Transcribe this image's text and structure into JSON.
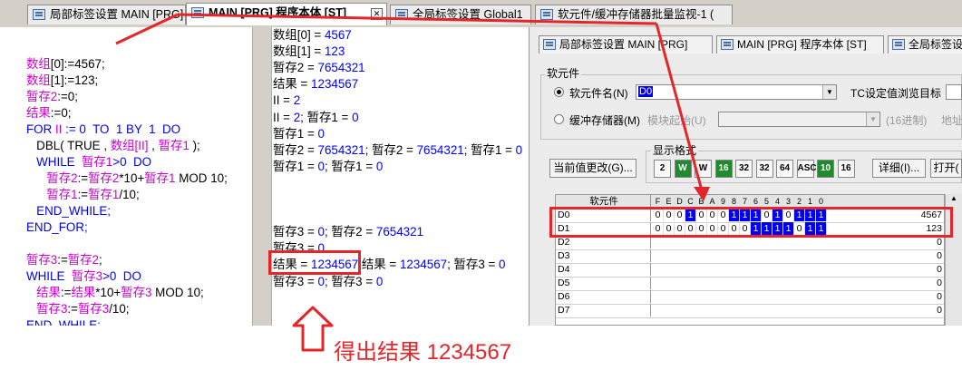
{
  "tabs": [
    {
      "label": "局部标签设置 MAIN [PRG]"
    },
    {
      "label": "MAIN [PRG] 程序本体 [ST]"
    },
    {
      "label": "全局标签设置 Global1"
    },
    {
      "label": "软元件/缓冲存储器批量监视-1 ("
    }
  ],
  "code": [
    [
      {
        "t": "数组",
        "c": "pk"
      },
      {
        "t": "[0]:=4567;",
        "c": "bk"
      }
    ],
    [
      {
        "t": "数组",
        "c": "pk"
      },
      {
        "t": "[1]:=123;",
        "c": "bk"
      }
    ],
    [
      {
        "t": "暂存2",
        "c": "pk"
      },
      {
        "t": ":=0;",
        "c": "bk"
      }
    ],
    [
      {
        "t": "结果",
        "c": "pk"
      },
      {
        "t": ":=0;",
        "c": "bk"
      }
    ],
    [
      {
        "t": "FOR ",
        "c": "bl"
      },
      {
        "t": "II",
        "c": "pk"
      },
      {
        "t": " := 0  TO  1 BY  1  DO",
        "c": "bl"
      }
    ],
    [
      {
        "t": "   DBL( TRUE , ",
        "c": "bk"
      },
      {
        "t": "数组",
        "c": "pk"
      },
      {
        "t": "[II]",
        "c": "pk"
      },
      {
        "t": " , ",
        "c": "bk"
      },
      {
        "t": "暂存1",
        "c": "pk"
      },
      {
        "t": " );",
        "c": "bk"
      }
    ],
    [
      {
        "t": "   WHILE  ",
        "c": "bl"
      },
      {
        "t": "暂存1",
        "c": "pk"
      },
      {
        "t": ">0  DO",
        "c": "bl"
      }
    ],
    [
      {
        "t": "      ",
        "c": "bk"
      },
      {
        "t": "暂存2",
        "c": "pk"
      },
      {
        "t": ":=",
        "c": "bk"
      },
      {
        "t": "暂存2",
        "c": "pk"
      },
      {
        "t": "*10+",
        "c": "bk"
      },
      {
        "t": "暂存1",
        "c": "pk"
      },
      {
        "t": " MOD 10;",
        "c": "bk"
      }
    ],
    [
      {
        "t": "      ",
        "c": "bk"
      },
      {
        "t": "暂存1",
        "c": "pk"
      },
      {
        "t": ":=",
        "c": "bk"
      },
      {
        "t": "暂存1",
        "c": "pk"
      },
      {
        "t": "/10;",
        "c": "bk"
      }
    ],
    [
      {
        "t": "   END_WHILE;",
        "c": "bl"
      }
    ],
    [
      {
        "t": "END_FOR;",
        "c": "bl"
      }
    ],
    [
      {
        "t": "",
        "c": "bk"
      }
    ],
    [
      {
        "t": "暂存3",
        "c": "pk"
      },
      {
        "t": ":=",
        "c": "bk"
      },
      {
        "t": "暂存2",
        "c": "pk"
      },
      {
        "t": ";",
        "c": "bk"
      }
    ],
    [
      {
        "t": "WHILE  ",
        "c": "bl"
      },
      {
        "t": "暂存3",
        "c": "pk"
      },
      {
        "t": ">0  DO",
        "c": "bl"
      }
    ],
    [
      {
        "t": "   ",
        "c": "bk"
      },
      {
        "t": "结果",
        "c": "pk"
      },
      {
        "t": ":=",
        "c": "bk"
      },
      {
        "t": "结果",
        "c": "pk"
      },
      {
        "t": "*10+",
        "c": "bk"
      },
      {
        "t": "暂存3",
        "c": "pk"
      },
      {
        "t": " MOD 10;",
        "c": "bk"
      }
    ],
    [
      {
        "t": "   ",
        "c": "bk"
      },
      {
        "t": "暂存3",
        "c": "pk"
      },
      {
        "t": ":=",
        "c": "bk"
      },
      {
        "t": "暂存3",
        "c": "pk"
      },
      {
        "t": "/10;",
        "c": "bk"
      }
    ],
    [
      {
        "t": "END_WHILE;",
        "c": "bl"
      }
    ]
  ],
  "monitor": [
    [
      {
        "t": "数组[0] = "
      },
      {
        "t": "4567",
        "n": true
      }
    ],
    [
      {
        "t": "数组[1] = "
      },
      {
        "t": "123",
        "n": true
      }
    ],
    [
      {
        "t": "暂存2 = "
      },
      {
        "t": "7654321",
        "n": true
      }
    ],
    [
      {
        "t": "结果 = "
      },
      {
        "t": "1234567",
        "n": true
      }
    ],
    [
      {
        "t": "II = "
      },
      {
        "t": "2",
        "n": true
      }
    ],
    [
      {
        "t": "II = "
      },
      {
        "t": "2",
        "n": true
      },
      {
        "t": "; 暂存1 = "
      },
      {
        "t": "0",
        "n": true
      }
    ],
    [
      {
        "t": "暂存1 = "
      },
      {
        "t": "0",
        "n": true
      }
    ],
    [
      {
        "t": "暂存2 = "
      },
      {
        "t": "7654321",
        "n": true
      },
      {
        "t": "; 暂存2 = "
      },
      {
        "t": "7654321",
        "n": true
      },
      {
        "t": "; 暂存1 = "
      },
      {
        "t": "0",
        "n": true
      }
    ],
    [
      {
        "t": "暂存1 = "
      },
      {
        "t": "0",
        "n": true
      },
      {
        "t": "; 暂存1 = "
      },
      {
        "t": "0",
        "n": true
      }
    ],
    [],
    [],
    [],
    [
      {
        "t": "暂存3 = "
      },
      {
        "t": "0",
        "n": true
      },
      {
        "t": "; 暂存2 = "
      },
      {
        "t": "7654321",
        "n": true
      }
    ],
    [
      {
        "t": "暂存3 = "
      },
      {
        "t": "0",
        "n": true
      }
    ],
    [
      {
        "t": "结果 = "
      },
      {
        "t": "1234567",
        "n": true
      },
      {
        "t": " 结果 = "
      },
      {
        "t": "1234567",
        "n": true
      },
      {
        "t": "; 暂存3 = "
      },
      {
        "t": "0",
        "n": true
      }
    ],
    [
      {
        "t": "暂存3 = "
      },
      {
        "t": "0",
        "n": true
      },
      {
        "t": "; 暂存3 = "
      },
      {
        "t": "0",
        "n": true
      }
    ]
  ],
  "panel": {
    "tabs": [
      "局部标签设置 MAIN [PRG]",
      "MAIN [PRG] 程序本体 [ST]",
      "全局标签设"
    ],
    "group_title": "软元件",
    "radio_device": "软元件名(N)",
    "device_value": "D0",
    "tc_label": "TC设定值浏览目标",
    "radio_buffer": "缓冲存储器(M)",
    "module_label": "模块起始(U)",
    "hex_label": "(16进制)",
    "addr_label": "地址",
    "display_format": "显示格式",
    "change_btn": "当前值更改(G)...",
    "fmt_buttons": [
      "2",
      "W",
      "W",
      "16",
      "32",
      "32",
      "64",
      "ASC",
      "10",
      "16"
    ],
    "detail_btn": "详细(I)...",
    "open_btn": "打开(",
    "grid_header_name": "软元件",
    "bit_headers": [
      "F",
      "E",
      "D",
      "C",
      "B",
      "A",
      "9",
      "8",
      "7",
      "6",
      "5",
      "4",
      "3",
      "2",
      "1",
      "0"
    ],
    "rows": [
      {
        "name": "D0",
        "bits": [
          0,
          0,
          0,
          1,
          0,
          0,
          0,
          1,
          1,
          1,
          0,
          1,
          0,
          1,
          1,
          1
        ],
        "value": "4567"
      },
      {
        "name": "D1",
        "bits": [
          0,
          0,
          0,
          0,
          0,
          0,
          0,
          0,
          0,
          1,
          1,
          1,
          1,
          0,
          1,
          1
        ],
        "value": "123"
      },
      {
        "name": "D2",
        "bits": [
          0,
          0,
          0,
          0,
          0,
          0,
          0,
          0,
          0,
          0,
          0,
          0,
          0,
          0,
          0,
          0
        ],
        "value": "0"
      },
      {
        "name": "D3",
        "bits": [
          0,
          0,
          0,
          0,
          0,
          0,
          0,
          0,
          0,
          0,
          0,
          0,
          0,
          0,
          0,
          0
        ],
        "value": "0"
      },
      {
        "name": "D4",
        "bits": [
          0,
          0,
          0,
          0,
          0,
          0,
          0,
          0,
          0,
          0,
          0,
          0,
          0,
          0,
          0,
          0
        ],
        "value": "0"
      },
      {
        "name": "D5",
        "bits": [
          0,
          0,
          0,
          0,
          0,
          0,
          0,
          0,
          0,
          0,
          0,
          0,
          0,
          0,
          0,
          0
        ],
        "value": "0"
      },
      {
        "name": "D6",
        "bits": [
          0,
          0,
          0,
          0,
          0,
          0,
          0,
          0,
          0,
          0,
          0,
          0,
          0,
          0,
          0,
          0
        ],
        "value": "0"
      },
      {
        "name": "D7",
        "bits": [
          0,
          0,
          0,
          0,
          0,
          0,
          0,
          0,
          0,
          0,
          0,
          0,
          0,
          0,
          0,
          0
        ],
        "value": "0"
      }
    ]
  },
  "annotation": {
    "text": "得出结果 1234567",
    "color": "#e4262a"
  }
}
